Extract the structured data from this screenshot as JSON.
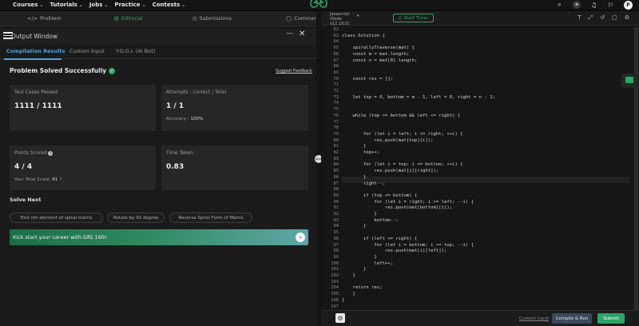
{
  "topnav": {
    "items": [
      "Courses",
      "Tutorials",
      "Jobs",
      "Practice",
      "Contests"
    ],
    "avatar_letter": "P",
    "brand_color": "#2fa368"
  },
  "left_tabs": [
    "Problem",
    "Editorial",
    "Submissions",
    "Comments"
  ],
  "output": {
    "title": "Output Window",
    "subtabs": [
      "Compilation Results",
      "Custom Input",
      "Y.O.G.I. (AI Bot)"
    ],
    "status": "Problem Solved Successfully",
    "feedback_link": "Suggest Feedback",
    "cards": {
      "tests": {
        "label": "Test Cases Passed",
        "value": "1111 / 1111"
      },
      "attempts": {
        "label": "Attempts : Correct / Total",
        "value": "1 / 1",
        "accuracy_label": "Accuracy :",
        "accuracy_value": "100%"
      },
      "points": {
        "label": "Points Scored",
        "value": "4 / 4",
        "total_label": "Your Total Score:",
        "total_value": "91"
      },
      "time": {
        "label": "Time Taken",
        "value": "0.83"
      }
    },
    "solve_next_label": "Solve Next",
    "solve_next": [
      "Find nth element of spiral matrix",
      "Rotate by 90 degree",
      "Reverse Spiral Form of Matrix"
    ],
    "banner": "Kick start your career with GfG 160!"
  },
  "editor": {
    "language_line1": "Javascript",
    "language_line2": "(Node",
    "language_line3": "v12.19.0)",
    "timer_label": "Start Timer",
    "line_numbers": [
      "62",
      "63",
      "64",
      "65",
      "66",
      "67",
      "68",
      "69",
      "70",
      "71",
      "72",
      "73",
      "74",
      "75",
      "76",
      "77",
      "78",
      "79",
      "80",
      "81",
      "82",
      "83",
      "84",
      "85",
      "86",
      "87",
      "88",
      "89",
      "90",
      "91",
      "92",
      "93",
      "94",
      "95",
      "96",
      "97",
      "98",
      "99",
      "100",
      "101",
      "102",
      "103",
      "104",
      "105",
      "106",
      "107"
    ],
    "lines": [
      "",
      "class Solution {",
      "",
      "    spirallyTraverse(mat) {",
      "    const m = mat.length;",
      "    const n = mat[0].length;",
      "",
      "",
      "    const res = [];",
      "",
      "",
      "    let top = 0, bottom = m - 1, left = 0, right = n - 1;",
      "",
      "",
      "    while (top <= bottom && left <= right) {",
      "",
      "",
      "        for (let i = left; i <= right; ++i) {",
      "            res.push(mat[top][i]);",
      "        }",
      "        top++;",
      "",
      "        for (let i = top; i <= bottom; ++i) {",
      "            res.push(mat[i][right]);",
      "        }",
      "        right--;",
      "",
      "        if (top <= bottom) {",
      "            for (let i = right; i >= left; --i) {",
      "                res.push(mat[bottom][i]);",
      "            }",
      "            bottom--;",
      "        }",
      "",
      "        if (left <= right) {",
      "            for (let i = bottom; i >= top; --i) {",
      "                res.push(mat[i][left]);",
      "            }",
      "            left++;",
      "        }",
      "    }",
      "",
      "    return res;",
      "    }",
      "}",
      ""
    ],
    "custom_input_label": "Custom Input",
    "compile_label": "Compile & Run",
    "submit_label": "Submit"
  }
}
